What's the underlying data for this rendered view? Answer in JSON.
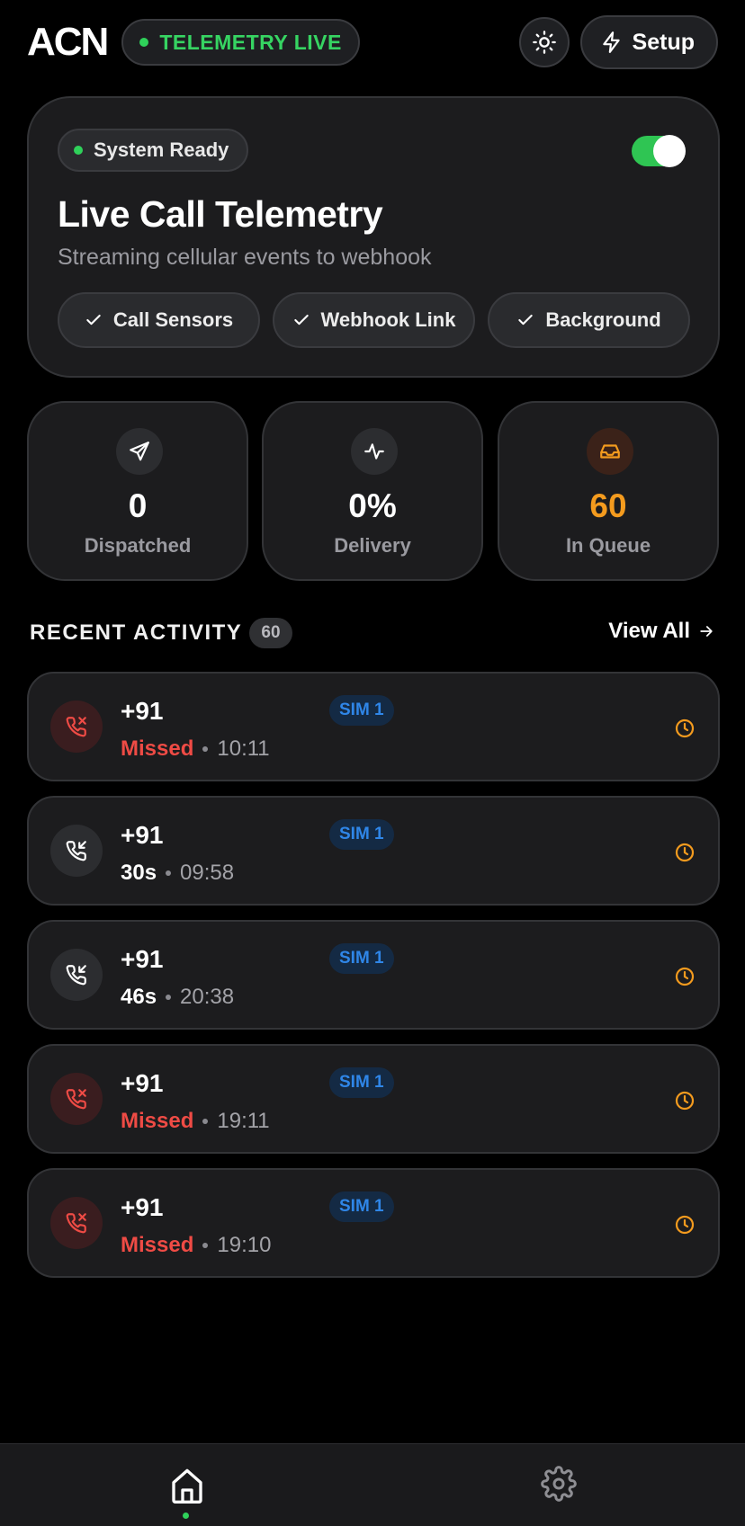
{
  "header": {
    "logo": "ACN",
    "status_pill": "TELEMETRY LIVE",
    "setup_label": "Setup"
  },
  "hero": {
    "status": "System Ready",
    "title": "Live Call Telemetry",
    "subtitle": "Streaming cellular events to webhook",
    "toggle_on": true,
    "chips": [
      "Call Sensors",
      "Webhook Link",
      "Background"
    ]
  },
  "stats": [
    {
      "value": "0",
      "label": "Dispatched",
      "icon": "send-icon"
    },
    {
      "value": "0%",
      "label": "Delivery",
      "icon": "activity-icon"
    },
    {
      "value": "60",
      "label": "In Queue",
      "icon": "inbox-icon"
    }
  ],
  "recent": {
    "title": "RECENT ACTIVITY",
    "count": "60",
    "view_all": "View All"
  },
  "calls": [
    {
      "number": "+91",
      "status": "Missed",
      "time": "10:11",
      "sim": "SIM 1",
      "type": "missed"
    },
    {
      "number": "+91",
      "status": "30s",
      "time": "09:58",
      "sim": "SIM 1",
      "type": "incoming"
    },
    {
      "number": "+91",
      "status": "46s",
      "time": "20:38",
      "sim": "SIM 1",
      "type": "incoming"
    },
    {
      "number": "+91",
      "status": "Missed",
      "time": "19:11",
      "sim": "SIM 1",
      "type": "missed"
    },
    {
      "number": "+91",
      "status": "Missed",
      "time": "19:10",
      "sim": "SIM 1",
      "type": "missed"
    }
  ],
  "colors": {
    "accent_green": "#2fd15a",
    "missed_red": "#ef4b45",
    "queue_orange": "#f49b1e",
    "sim_blue": "#2f86e8"
  }
}
